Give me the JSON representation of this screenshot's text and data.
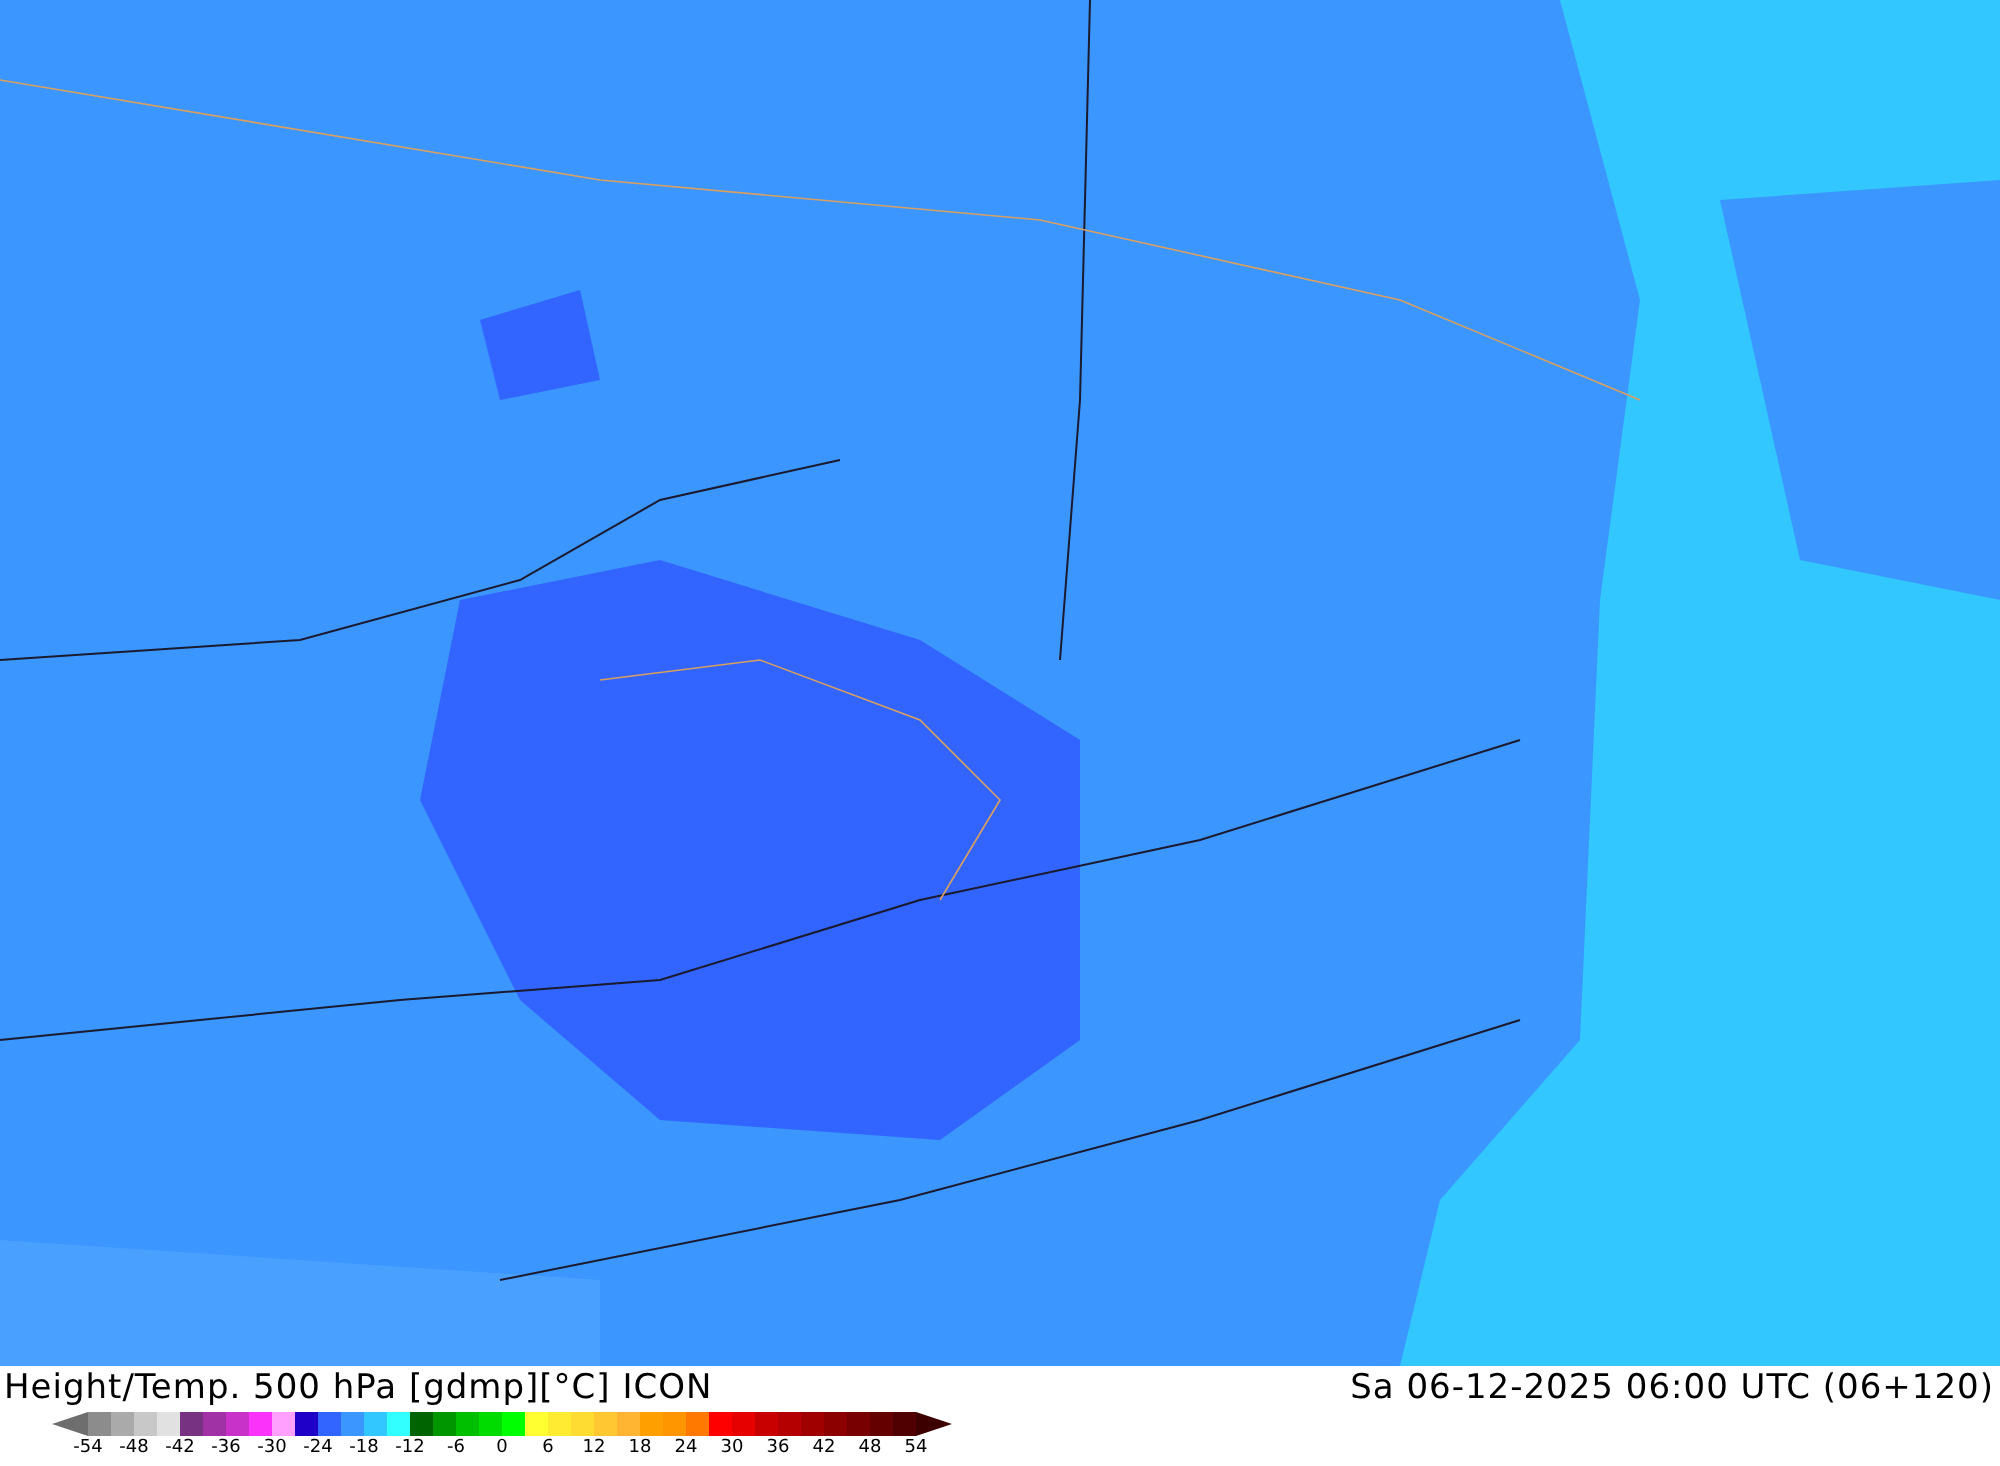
{
  "footer": {
    "title": "Height/Temp. 500 hPa [gdmp][°C] ICON",
    "valid_time": "Sa 06-12-2025 06:00 UTC (06+120)"
  },
  "legend": {
    "ends": [
      {
        "color": "#6e6e6e"
      },
      {
        "color": "#3c0000"
      }
    ],
    "swatches": [
      {
        "color": "#8c8c8c"
      },
      {
        "color": "#aaaaaa"
      },
      {
        "color": "#c8c8c8"
      },
      {
        "color": "#e1e1e1"
      },
      {
        "color": "#783282"
      },
      {
        "color": "#a032a5"
      },
      {
        "color": "#c832c8"
      },
      {
        "color": "#fa32fa"
      },
      {
        "color": "#ffa0ff"
      },
      {
        "color": "#1e00c8"
      },
      {
        "color": "#3264ff"
      },
      {
        "color": "#3c96ff"
      },
      {
        "color": "#32c8ff"
      },
      {
        "color": "#32ffff"
      },
      {
        "color": "#006400"
      },
      {
        "color": "#009600"
      },
      {
        "color": "#00be00"
      },
      {
        "color": "#00dc00"
      },
      {
        "color": "#00ff00"
      },
      {
        "color": "#ffff32"
      },
      {
        "color": "#ffeb32"
      },
      {
        "color": "#ffdc32"
      },
      {
        "color": "#ffc832"
      },
      {
        "color": "#ffb432"
      },
      {
        "color": "#ffa000"
      },
      {
        "color": "#ff9600"
      },
      {
        "color": "#ff7800"
      },
      {
        "color": "#ff0000"
      },
      {
        "color": "#e60000"
      },
      {
        "color": "#c80000"
      },
      {
        "color": "#b40000"
      },
      {
        "color": "#a00000"
      },
      {
        "color": "#8c0000"
      },
      {
        "color": "#780000"
      },
      {
        "color": "#640000"
      },
      {
        "color": "#500000"
      }
    ],
    "ticks": [
      "-54",
      "-48",
      "-42",
      "-36",
      "-30",
      "-24",
      "-18",
      "-12",
      "-6",
      "0",
      "6",
      "12",
      "18",
      "24",
      "30",
      "36",
      "42",
      "48",
      "54"
    ]
  }
}
